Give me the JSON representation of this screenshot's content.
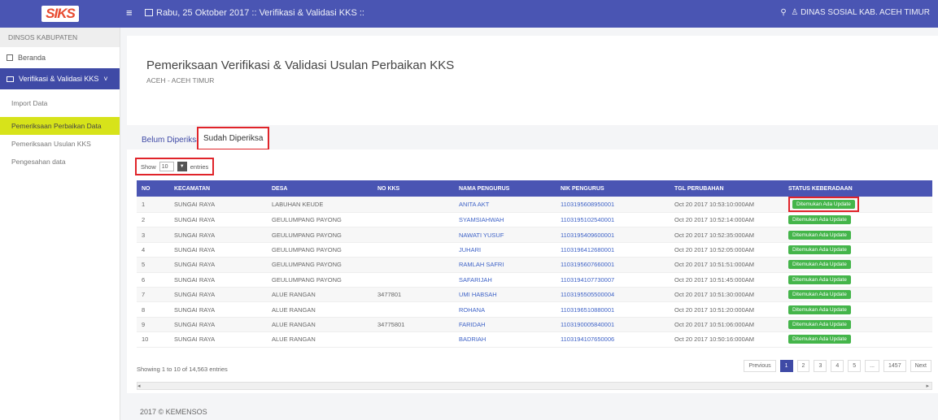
{
  "app": {
    "logo_text": "SIKS"
  },
  "topbar": {
    "datebar": "Rabu, 25 Oktober 2017 :: Verifikasi & Validasi KKS ::",
    "user": "DINAS SOSIAL KAB. ACEH TIMUR"
  },
  "sidebar": {
    "heading": "DINSOS KABUPATEN",
    "items": [
      {
        "label": "Beranda"
      },
      {
        "label": "Verifikasi & Validasi KKS"
      }
    ],
    "subitems": [
      {
        "label": "Import Data"
      },
      {
        "label": "Pemeriksaan Perbaikan Data"
      },
      {
        "label": "Pemeriksaan Usulan KKS"
      },
      {
        "label": "Pengesahan data"
      }
    ]
  },
  "header": {
    "title": "Pemeriksaan Verifikasi & Validasi Usulan Perbaikan KKS",
    "breadcrumb": "ACEH - ACEH TIMUR"
  },
  "tabs": [
    {
      "label": "Belum Diperiksa"
    },
    {
      "label": "Sudah Diperiksa"
    }
  ],
  "length_control": {
    "show_label": "Show",
    "value": "10",
    "entries_label": "entries"
  },
  "table": {
    "columns": [
      "NO",
      "KECAMATAN",
      "DESA",
      "NO KKS",
      "NAMA PENGURUS",
      "NIK PENGURUS",
      "TGL PERUBAHAN",
      "STATUS KEBERADAAN"
    ],
    "rows": [
      [
        "1",
        "SUNGAI RAYA",
        "LABUHAN KEUDE",
        "",
        "ANITA AKT",
        "1103195608950001",
        "Oct 20 2017 10:53:10:000AM",
        "Ditemukan Ada Update"
      ],
      [
        "2",
        "SUNGAI RAYA",
        "GEULUMPANG PAYONG",
        "",
        "SYAMSIAHWAH",
        "1103195102540001",
        "Oct 20 2017 10:52:14:000AM",
        "Ditemukan Ada Update"
      ],
      [
        "3",
        "SUNGAI RAYA",
        "GEULUMPANG PAYONG",
        "",
        "NAWATI YUSUF",
        "1103195409600001",
        "Oct 20 2017 10:52:35:000AM",
        "Ditemukan Ada Update"
      ],
      [
        "4",
        "SUNGAI RAYA",
        "GEULUMPANG PAYONG",
        "",
        "JUHARI",
        "1103196412680001",
        "Oct 20 2017 10:52:05:000AM",
        "Ditemukan Ada Update"
      ],
      [
        "5",
        "SUNGAI RAYA",
        "GEULUMPANG PAYONG",
        "",
        "RAMLAH SAFRI",
        "1103195607660001",
        "Oct 20 2017 10:51:51:000AM",
        "Ditemukan Ada Update"
      ],
      [
        "6",
        "SUNGAI RAYA",
        "GEULUMPANG PAYONG",
        "",
        "SAFARIJAH",
        "1103194107730007",
        "Oct 20 2017 10:51:45:000AM",
        "Ditemukan Ada Update"
      ],
      [
        "7",
        "SUNGAI RAYA",
        "ALUE RANGAN",
        "3477801",
        "UMI HABSAH",
        "1103195505500004",
        "Oct 20 2017 10:51:30:000AM",
        "Ditemukan Ada Update"
      ],
      [
        "8",
        "SUNGAI RAYA",
        "ALUE RANGAN",
        "",
        "ROHANA",
        "1103196510880001",
        "Oct 20 2017 10:51:20:000AM",
        "Ditemukan Ada Update"
      ],
      [
        "9",
        "SUNGAI RAYA",
        "ALUE RANGAN",
        "34775801",
        "FARIDAH",
        "1103190005840001",
        "Oct 20 2017 10:51:06:000AM",
        "Ditemukan Ada Update"
      ],
      [
        "10",
        "SUNGAI RAYA",
        "ALUE RANGAN",
        "",
        "BADRIAH",
        "1103194107650006",
        "Oct 20 2017 10:50:16:000AM",
        "Ditemukan Ada Update"
      ]
    ]
  },
  "info": "Showing 1 to 10 of 14,563 entries",
  "pager": {
    "prev": "Previous",
    "pages": [
      "1",
      "2",
      "3",
      "4",
      "5",
      "...",
      "1457"
    ],
    "next": "Next"
  },
  "footer": "2017 © KEMENSOS",
  "colors": {
    "primary": "#4a55b3",
    "highlight": "#d7e31a",
    "badge": "#44b54a",
    "callout": "#e0242a"
  }
}
